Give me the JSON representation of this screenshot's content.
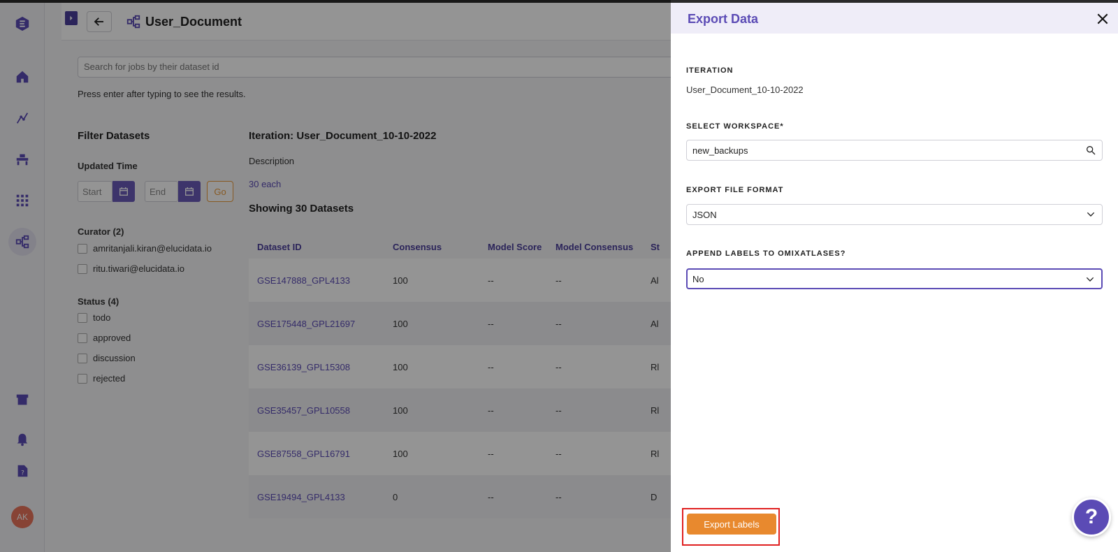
{
  "header": {
    "title": "User_Document"
  },
  "search": {
    "placeholder": "Search for jobs by their dataset id",
    "hint": "Press enter after typing to see the results."
  },
  "filters": {
    "title": "Filter Datasets",
    "updated_time_label": "Updated Time",
    "start_placeholder": "Start",
    "end_placeholder": "End",
    "go_label": "Go",
    "curator_title": "Curator (2)",
    "curators": [
      "amritanjali.kiran@elucidata.io",
      "ritu.tiwari@elucidata.io"
    ],
    "status_title": "Status (4)",
    "statuses": [
      "todo",
      "approved",
      "discussion",
      "rejected"
    ]
  },
  "iteration": {
    "title": "Iteration: User_Document_10-10-2022",
    "description_label": "Description",
    "description_value": "30 each",
    "showing": "Showing 30 Datasets"
  },
  "table": {
    "columns": [
      "Dataset ID",
      "Consensus",
      "Model Score",
      "Model Consensus",
      "St"
    ],
    "rows": [
      {
        "id": "GSE147888_GPL4133",
        "consensus": "100",
        "score": "--",
        "model_consensus": "--",
        "status": "Al"
      },
      {
        "id": "GSE175448_GPL21697",
        "consensus": "100",
        "score": "--",
        "model_consensus": "--",
        "status": "Al"
      },
      {
        "id": "GSE36139_GPL15308",
        "consensus": "100",
        "score": "--",
        "model_consensus": "--",
        "status": "Rl"
      },
      {
        "id": "GSE35457_GPL10558",
        "consensus": "100",
        "score": "--",
        "model_consensus": "--",
        "status": "Rl"
      },
      {
        "id": "GSE87558_GPL16791",
        "consensus": "100",
        "score": "--",
        "model_consensus": "--",
        "status": "Rl"
      },
      {
        "id": "GSE19494_GPL4133",
        "consensus": "0",
        "score": "--",
        "model_consensus": "--",
        "status": "D"
      }
    ]
  },
  "drawer": {
    "title": "Export Data",
    "iteration_label": "ITERATION",
    "iteration_value": "User_Document_10-10-2022",
    "workspace_label": "SELECT WORKSPACE*",
    "workspace_value": "new_backups",
    "format_label": "EXPORT FILE FORMAT",
    "format_value": "JSON",
    "append_label": "APPEND LABELS TO OMIXATLASES?",
    "append_value": "No",
    "export_label": "Export Labels"
  },
  "user": {
    "initials": "AK"
  },
  "help": {
    "label": "?"
  },
  "colors": {
    "accent": "#5b4bb5",
    "export": "#e8892e",
    "highlight": "#e02020"
  }
}
